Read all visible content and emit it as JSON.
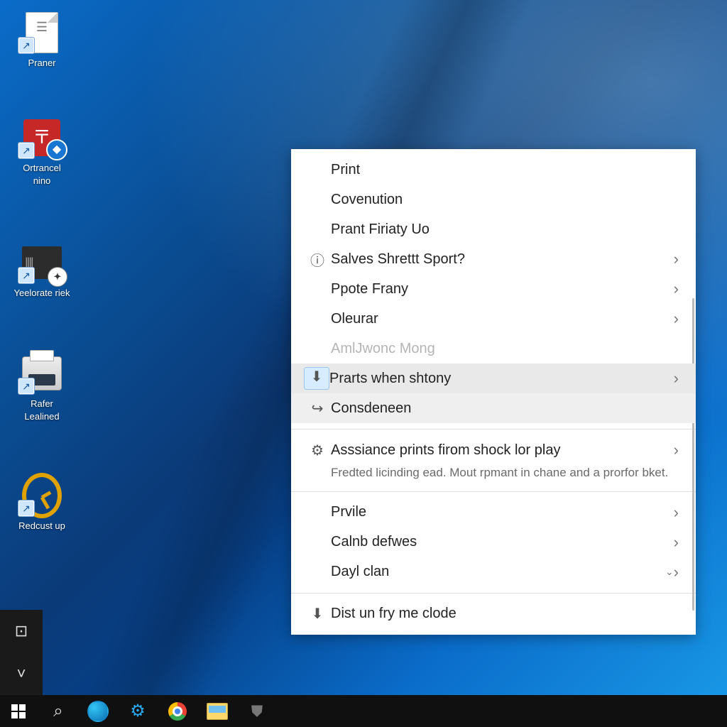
{
  "desktop_icons": {
    "praner": {
      "label": "Praner"
    },
    "ortrancel": {
      "label": "Ortrancel\nnino"
    },
    "yeelorate": {
      "label": "Yeelorate riek"
    },
    "rafer": {
      "label": "Rafer\nLealined"
    },
    "redcust": {
      "label": "Redcust up"
    }
  },
  "context_menu": {
    "print": "Print",
    "covenution": "Covenution",
    "prant_firiaty": "Prant Firiaty Uo",
    "salves": "Salves Shrettt Sport?",
    "ppote": "Ppote Frany",
    "oleurar": "Oleurar",
    "amijwonc": "AmlJwonc Mong",
    "prarts": "Prarts when shtony",
    "consdeneen": "Consdeneen",
    "asssiance": "Asssiance prints firom shock lor play",
    "asssiance_sub": "Fredted licinding ead. Mout rpmant in chane and a prorfor bket.",
    "pvile": "Prvile",
    "calnb": "Calnb defwes",
    "dayl": "Dayl clan",
    "dist": "Dist un fry me clode"
  },
  "side_tiles": {
    "tile1_icon": "⊡",
    "tile2_icon": "˅"
  },
  "taskbar": {
    "start": "Start",
    "search": "Search",
    "edge": "Edge",
    "settings": "Settings",
    "chrome": "Chrome",
    "files": "File Explorer",
    "security": "Security"
  }
}
